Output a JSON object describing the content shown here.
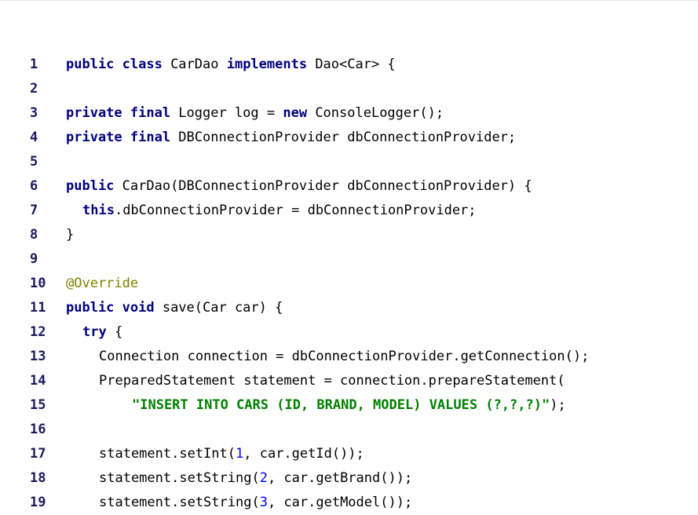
{
  "colors": {
    "keyword": "#000080",
    "string": "#008000",
    "number": "#0000ff",
    "annotation": "#808000",
    "line_number": "#1a1a5e",
    "background": "#ffffff"
  },
  "code": {
    "lines": [
      {
        "number": "1",
        "indent": 0,
        "tokens": [
          {
            "t": "kw",
            "v": "public class"
          },
          {
            "t": "plain",
            "v": " CarDao "
          },
          {
            "t": "kw",
            "v": "implements"
          },
          {
            "t": "plain",
            "v": " Dao<Car> {"
          }
        ]
      },
      {
        "number": "2",
        "indent": 0,
        "tokens": []
      },
      {
        "number": "3",
        "indent": 0,
        "tokens": [
          {
            "t": "kw",
            "v": "private final"
          },
          {
            "t": "plain",
            "v": " Logger log = "
          },
          {
            "t": "kw",
            "v": "new"
          },
          {
            "t": "plain",
            "v": " ConsoleLogger();"
          }
        ]
      },
      {
        "number": "4",
        "indent": 0,
        "tokens": [
          {
            "t": "kw",
            "v": "private final"
          },
          {
            "t": "plain",
            "v": " DBConnectionProvider dbConnectionProvider;"
          }
        ]
      },
      {
        "number": "5",
        "indent": 0,
        "tokens": []
      },
      {
        "number": "6",
        "indent": 0,
        "tokens": [
          {
            "t": "kw",
            "v": "public"
          },
          {
            "t": "plain",
            "v": " CarDao(DBConnectionProvider dbConnectionProvider) {"
          }
        ]
      },
      {
        "number": "7",
        "indent": 1,
        "tokens": [
          {
            "t": "kw",
            "v": "this"
          },
          {
            "t": "plain",
            "v": ".dbConnectionProvider = dbConnectionProvider;"
          }
        ]
      },
      {
        "number": "8",
        "indent": 0,
        "tokens": [
          {
            "t": "plain",
            "v": "}"
          }
        ]
      },
      {
        "number": "9",
        "indent": 0,
        "tokens": []
      },
      {
        "number": "10",
        "indent": 0,
        "tokens": [
          {
            "t": "anno",
            "v": "@Override"
          }
        ]
      },
      {
        "number": "11",
        "indent": 0,
        "tokens": [
          {
            "t": "kw",
            "v": "public void"
          },
          {
            "t": "plain",
            "v": " save(Car car) {"
          }
        ]
      },
      {
        "number": "12",
        "indent": 1,
        "tokens": [
          {
            "t": "kw",
            "v": "try"
          },
          {
            "t": "plain",
            "v": " {"
          }
        ]
      },
      {
        "number": "13",
        "indent": 2,
        "tokens": [
          {
            "t": "plain",
            "v": "Connection connection = dbConnectionProvider.getConnection();"
          }
        ]
      },
      {
        "number": "14",
        "indent": 2,
        "tokens": [
          {
            "t": "plain",
            "v": "PreparedStatement statement = connection.prepareStatement("
          }
        ]
      },
      {
        "number": "15",
        "indent": 4,
        "tokens": [
          {
            "t": "str",
            "v": "\"INSERT INTO CARS (ID, BRAND, MODEL) VALUES (?,?,?)\""
          },
          {
            "t": "plain",
            "v": ");"
          }
        ]
      },
      {
        "number": "16",
        "indent": 0,
        "tokens": []
      },
      {
        "number": "17",
        "indent": 2,
        "tokens": [
          {
            "t": "plain",
            "v": "statement.setInt("
          },
          {
            "t": "num",
            "v": "1"
          },
          {
            "t": "plain",
            "v": ", car.getId());"
          }
        ]
      },
      {
        "number": "18",
        "indent": 2,
        "tokens": [
          {
            "t": "plain",
            "v": "statement.setString("
          },
          {
            "t": "num",
            "v": "2"
          },
          {
            "t": "plain",
            "v": ", car.getBrand());"
          }
        ]
      },
      {
        "number": "19",
        "indent": 2,
        "tokens": [
          {
            "t": "plain",
            "v": "statement.setString("
          },
          {
            "t": "num",
            "v": "3"
          },
          {
            "t": "plain",
            "v": ", car.getModel());"
          }
        ]
      }
    ]
  }
}
